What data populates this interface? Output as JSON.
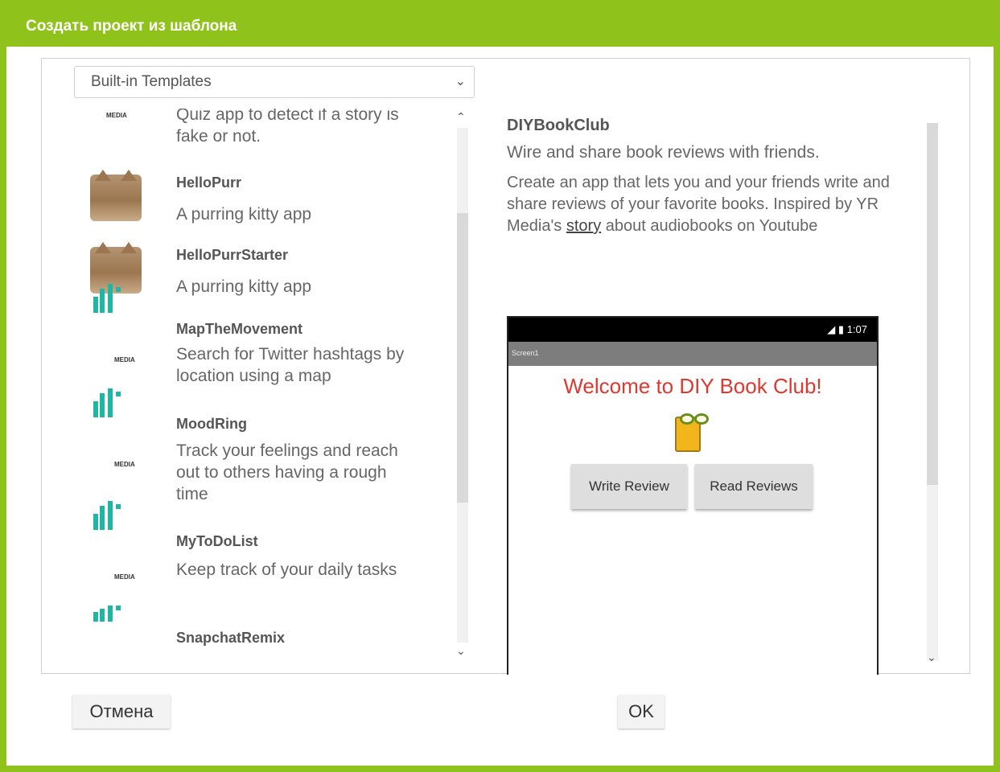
{
  "dialog": {
    "title": "Создать проект из шаблона",
    "cancel_label": "Отмена",
    "ok_label": "OK"
  },
  "template_select": {
    "selected": "Built-in Templates"
  },
  "templates": [
    {
      "name": "",
      "description": "Quiz app to detect if a story is fake or not.",
      "icon": "yr-media-logo"
    },
    {
      "name": "HelloPurr",
      "description": "A purring kitty app",
      "icon": "kitty-image"
    },
    {
      "name": "HelloPurrStarter",
      "description": "A purring kitty app",
      "icon": "kitty-image"
    },
    {
      "name": "MapTheMovement",
      "description": "Search for Twitter hashtags by location using a map",
      "icon": "yr-media-logo"
    },
    {
      "name": "MoodRing",
      "description": "Track your feelings and reach out to others having a rough time",
      "icon": "yr-media-logo"
    },
    {
      "name": "MyToDoList",
      "description": "Keep track of your daily tasks",
      "icon": "yr-media-logo"
    },
    {
      "name": "SnapchatRemix",
      "description": "",
      "icon": "yr-media-logo"
    }
  ],
  "icon_logo_text": "MEDIA",
  "details": {
    "title": "DIYBookClub",
    "subtitle": "Wire and share book reviews with friends.",
    "desc_before_link": "Create an app that lets you and your friends write and share reviews of your favorite books. Inspired by YR Media's ",
    "link_text": "story",
    "desc_after_link": " about audiobooks on Youtube"
  },
  "preview": {
    "status_time": "1:07",
    "app_bar_title": "Screen1",
    "welcome_text": "Welcome  to DIY Book Club!",
    "write_button": "Write  Review",
    "read_button": "Read Reviews"
  },
  "colors": {
    "accent_green": "#8fc21a",
    "welcome_red": "#e0382f",
    "logo_teal": "#1fb7a4"
  }
}
